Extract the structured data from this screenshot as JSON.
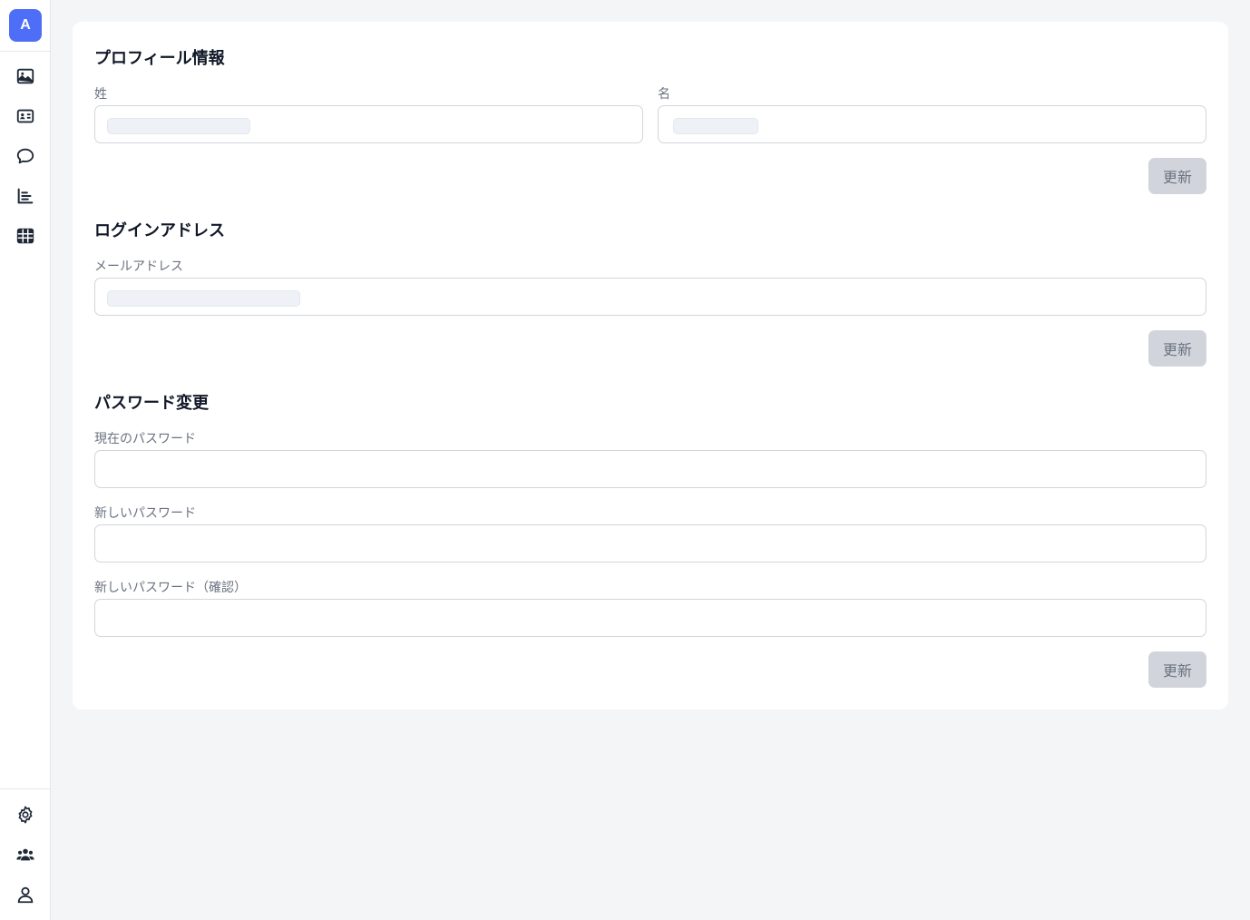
{
  "sidebar": {
    "logo_letter": "A",
    "accent": "#4f6ef7",
    "top_items": [
      {
        "icon": "image-icon"
      },
      {
        "icon": "id-card-icon"
      },
      {
        "icon": "chat-bubble-icon"
      },
      {
        "icon": "bar-chart-icon"
      },
      {
        "icon": "table-icon"
      }
    ],
    "bottom_items": [
      {
        "icon": "gear-icon"
      },
      {
        "icon": "users-icon"
      },
      {
        "icon": "user-icon"
      }
    ]
  },
  "profile": {
    "title": "プロフィール情報",
    "last_name_label": "姓",
    "first_name_label": "名",
    "update_label": "更新"
  },
  "login": {
    "title": "ログインアドレス",
    "email_label": "メールアドレス",
    "update_label": "更新"
  },
  "password": {
    "title": "パスワード変更",
    "current_label": "現在のパスワード",
    "new_label": "新しいパスワード",
    "confirm_label": "新しいパスワード（確認）",
    "update_label": "更新"
  }
}
